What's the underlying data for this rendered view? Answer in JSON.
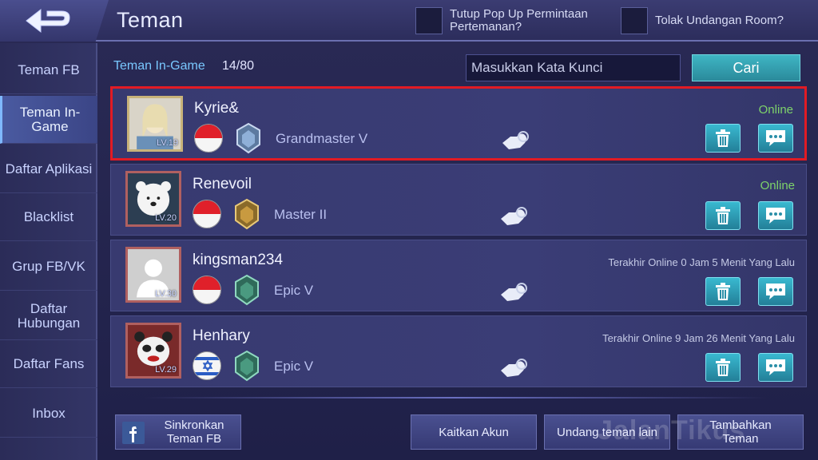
{
  "header": {
    "title": "Teman",
    "checkbox1_label": "Tutup Pop Up Permintaan Pertemanan?",
    "checkbox2_label": "Tolak Undangan Room?"
  },
  "sidebar": {
    "items": [
      {
        "label": "Teman FB"
      },
      {
        "label": "Teman In-Game"
      },
      {
        "label": "Daftar Aplikasi"
      },
      {
        "label": "Blacklist"
      },
      {
        "label": "Grup FB/VK"
      },
      {
        "label": "Daftar Hubungan"
      },
      {
        "label": "Daftar Fans"
      },
      {
        "label": "Inbox"
      }
    ],
    "active_index": 1
  },
  "main": {
    "section_label": "Teman In-Game",
    "count": "14/80",
    "search_placeholder": "Masukkan Kata Kunci",
    "search_button": "Cari"
  },
  "friends": [
    {
      "name": "Kyrie&",
      "level": "LV.19",
      "rank": "Grandmaster V",
      "status": "Online",
      "flag": "indonesia"
    },
    {
      "name": "Renevoil",
      "level": "LV.20",
      "rank": "Master II",
      "status": "Online",
      "flag": "indonesia"
    },
    {
      "name": "kingsman234",
      "level": "LV.30",
      "rank": "Epic V",
      "status": "Terakhir Online 0 Jam 5 Menit Yang Lalu",
      "flag": "indonesia"
    },
    {
      "name": "Henhary",
      "level": "LV.29",
      "rank": "Epic V",
      "status": "Terakhir Online 9 Jam 26 Menit Yang Lalu",
      "flag": "israel"
    }
  ],
  "footer": {
    "sync_fb": "Sinkronkan Teman FB",
    "link_account": "Kaitkan Akun",
    "invite": "Undang teman lain",
    "add_friend": "Tambahkan Teman"
  },
  "watermark": "JalanTikus",
  "colors": {
    "online": "#7ed36a",
    "accent": "#3fb5c4",
    "highlight": "#e21b24"
  }
}
